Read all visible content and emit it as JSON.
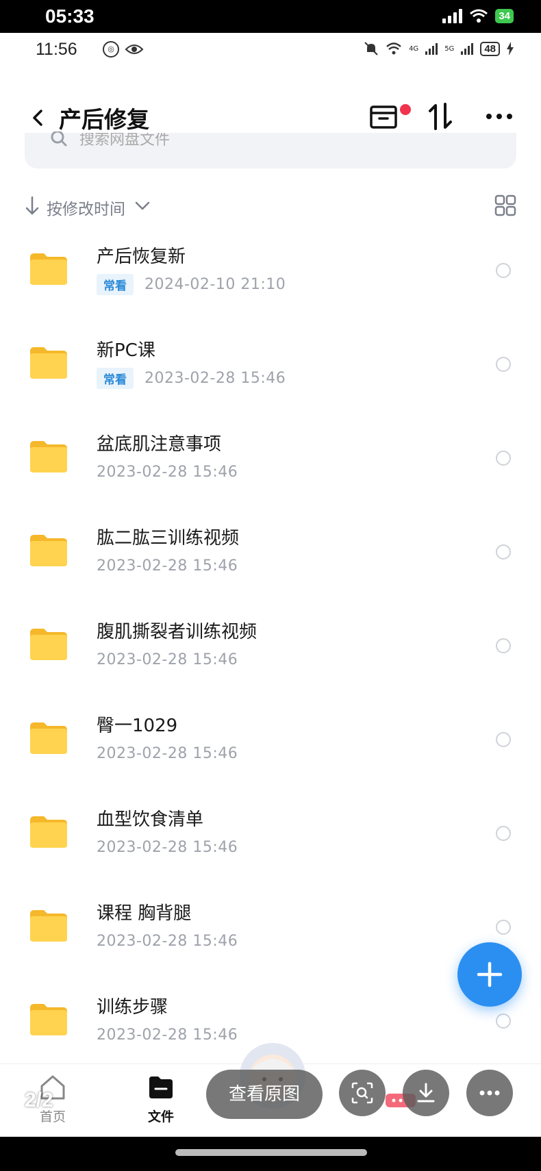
{
  "outer_status": {
    "time": "05:33",
    "battery": "34"
  },
  "inner_status": {
    "time": "11:56",
    "network_a": "4G",
    "network_b": "5G",
    "battery": "48"
  },
  "header": {
    "title": "产后修复"
  },
  "search": {
    "placeholder": "搜索网盘文件"
  },
  "sort": {
    "label": "按修改时间"
  },
  "files": [
    {
      "name": "产后恢复新",
      "tag": "常看",
      "date": "2024-02-10  21:10"
    },
    {
      "name": "新PC课",
      "tag": "常看",
      "date": "2023-02-28  15:46"
    },
    {
      "name": "盆底肌注意事项",
      "tag": "",
      "date": "2023-02-28  15:46"
    },
    {
      "name": "肱二肱三训练视频",
      "tag": "",
      "date": "2023-02-28  15:46"
    },
    {
      "name": "腹肌撕裂者训练视频",
      "tag": "",
      "date": "2023-02-28  15:46"
    },
    {
      "name": "臀一1029",
      "tag": "",
      "date": "2023-02-28  15:46"
    },
    {
      "name": "血型饮食清单",
      "tag": "",
      "date": "2023-02-28  15:46"
    },
    {
      "name": "课程 胸背腿",
      "tag": "",
      "date": "2023-02-28  15:46"
    },
    {
      "name": "训练步骤",
      "tag": "",
      "date": "2023-02-28  15:46"
    }
  ],
  "tabbar": {
    "home_label": "首页",
    "files_label": "文件",
    "page_indicator": "2/2"
  },
  "overlay": {
    "view_original": "查看原图"
  },
  "colors": {
    "accent": "#2b8ff1",
    "tag_text": "#2a8ad8",
    "tag_bg": "#e9f3fb",
    "folder": "#ffd24a",
    "badge": "#f0344e"
  }
}
